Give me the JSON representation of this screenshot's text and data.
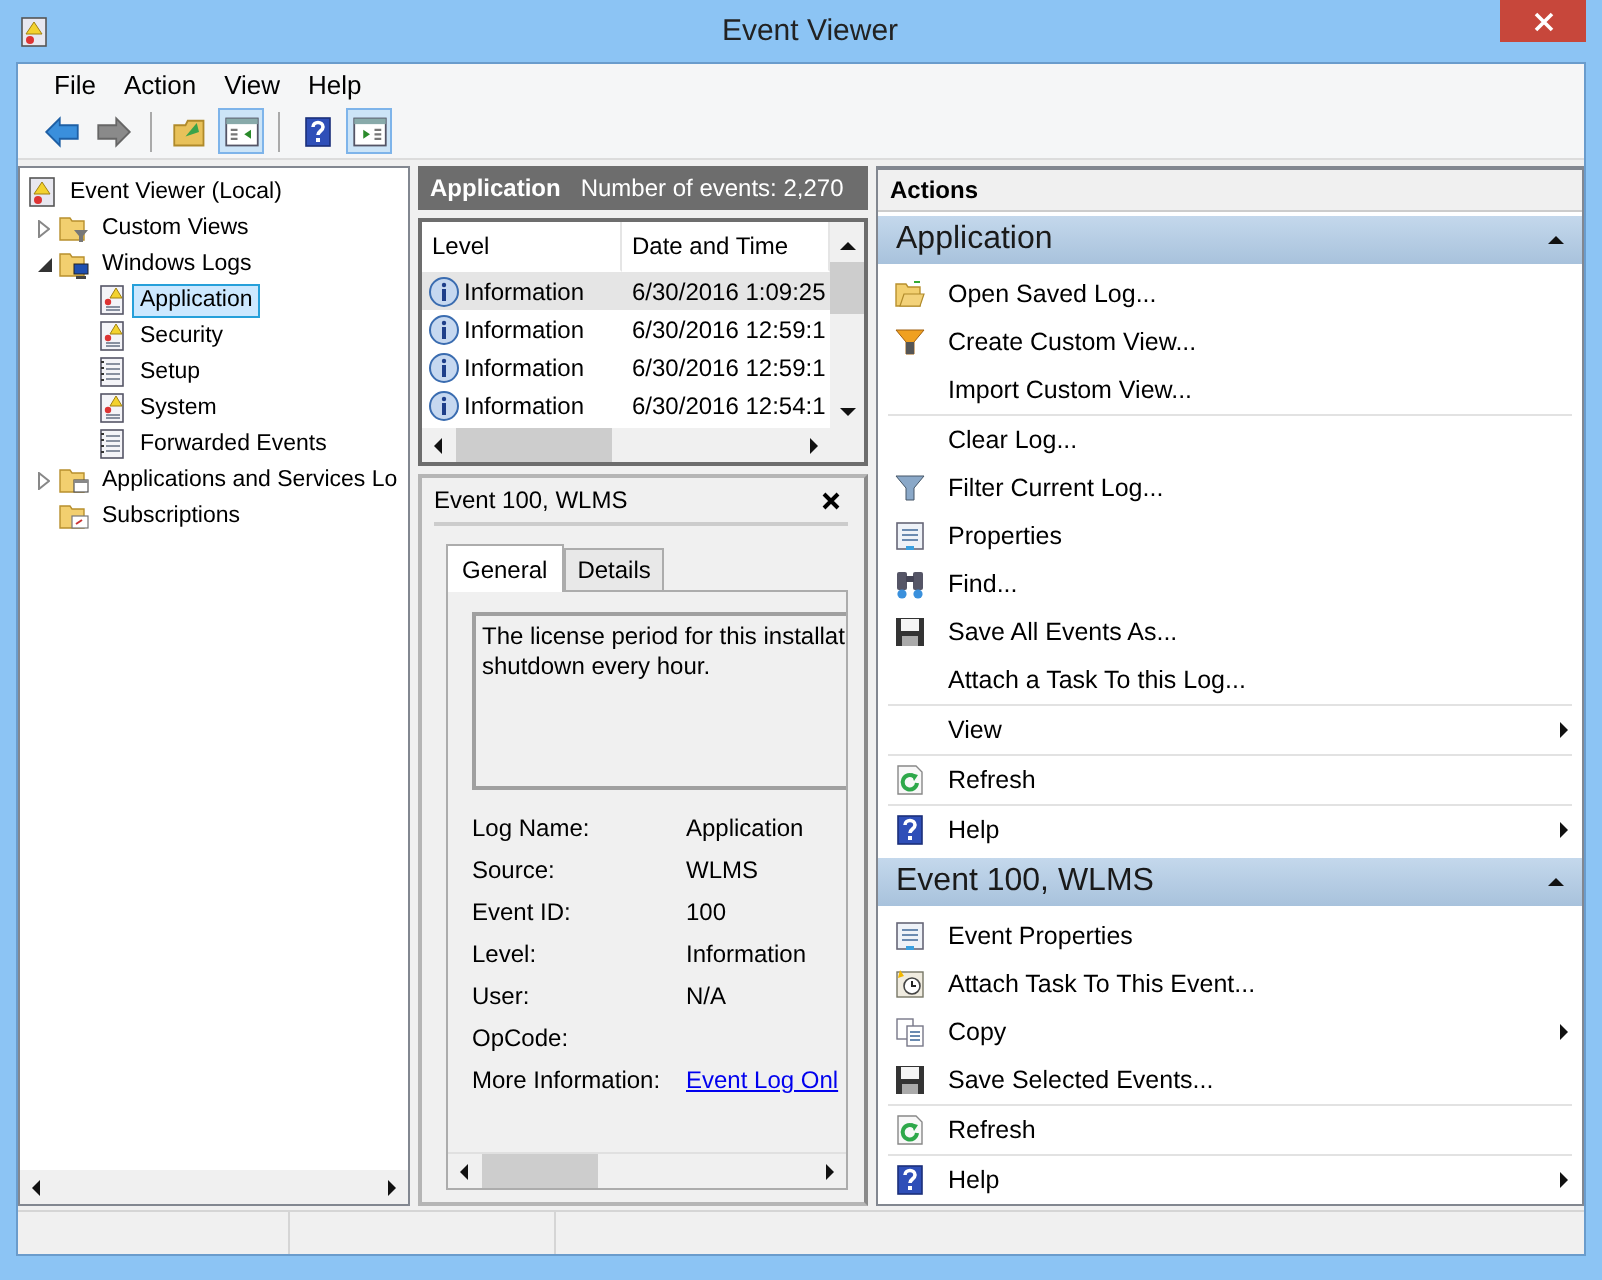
{
  "window": {
    "title": "Event Viewer"
  },
  "menu": [
    {
      "label": "File"
    },
    {
      "label": "Action"
    },
    {
      "label": "View"
    },
    {
      "label": "Help"
    }
  ],
  "toolbar": [
    {
      "kind": "back",
      "pressed": false
    },
    {
      "kind": "forward",
      "pressed": false
    },
    {
      "kind": "up",
      "pressed": false
    },
    {
      "kind": "tree-pane",
      "pressed": true
    },
    {
      "kind": "help",
      "pressed": false
    },
    {
      "kind": "action-pane",
      "pressed": true
    }
  ],
  "tree": [
    {
      "label": "Event Viewer (Local)",
      "kind": "root",
      "selected": false,
      "children": [
        {
          "label": "Custom Views",
          "kind": "folder-filter",
          "expanded": false,
          "selected": false
        },
        {
          "label": "Windows Logs",
          "kind": "folder-computer",
          "expanded": true,
          "selected": false,
          "children": [
            {
              "label": "Application",
              "kind": "log-alert",
              "selected": true
            },
            {
              "label": "Security",
              "kind": "log-alert",
              "selected": false
            },
            {
              "label": "Setup",
              "kind": "log",
              "selected": false
            },
            {
              "label": "System",
              "kind": "log-alert",
              "selected": false
            },
            {
              "label": "Forwarded Events",
              "kind": "log",
              "selected": false
            }
          ]
        },
        {
          "label": "Applications and Services Lo",
          "kind": "folder-window",
          "expanded": false,
          "selected": false
        },
        {
          "label": "Subscriptions",
          "kind": "subscriptions",
          "selected": false
        }
      ]
    }
  ],
  "events": {
    "title": "Application",
    "count": "Number of events: 2,270",
    "columns": [
      "Level",
      "Date and Time"
    ],
    "rows": [
      {
        "level": "Information",
        "date": "6/30/2016 1:09:25",
        "selected": true
      },
      {
        "level": "Information",
        "date": "6/30/2016 12:59:1",
        "selected": false
      },
      {
        "level": "Information",
        "date": "6/30/2016 12:59:1",
        "selected": false
      },
      {
        "level": "Information",
        "date": "6/30/2016 12:54:1",
        "selected": false
      }
    ]
  },
  "detail": {
    "title": "Event 100, WLMS",
    "tabs": [
      {
        "label": "General",
        "selected": true
      },
      {
        "label": "Details",
        "selected": false
      }
    ],
    "message": [
      "The license period for this installat",
      "shutdown every hour."
    ],
    "fields": [
      {
        "label": "Log Name:",
        "value": "Application",
        "kind": "text"
      },
      {
        "label": "Source:",
        "value": "WLMS",
        "kind": "text"
      },
      {
        "label": "Event ID:",
        "value": "100",
        "kind": "text"
      },
      {
        "label": "Level:",
        "value": "Information",
        "kind": "text"
      },
      {
        "label": "User:",
        "value": "N/A",
        "kind": "text"
      },
      {
        "label": "OpCode:",
        "kind": "text"
      },
      {
        "label": "More Information:",
        "value": "Event Log Onl",
        "kind": "link"
      }
    ]
  },
  "actions": {
    "title": "Actions",
    "sections": [
      {
        "title": "Application",
        "expanded": true,
        "items": [
          {
            "label": "Open Saved Log...",
            "kind": "open-folder"
          },
          {
            "label": "Create Custom View...",
            "kind": "filter-star"
          },
          {
            "label": "Import Custom View..."
          },
          {
            "label": "Clear Log...",
            "separator": true
          },
          {
            "label": "Filter Current Log...",
            "kind": "filter"
          },
          {
            "label": "Properties",
            "kind": "properties"
          },
          {
            "label": "Find...",
            "kind": "binoculars"
          },
          {
            "label": "Save All Events As...",
            "kind": "save"
          },
          {
            "label": "Attach a Task To this Log..."
          },
          {
            "label": "View",
            "separator": true,
            "submenu": true
          },
          {
            "label": "Refresh",
            "separator": true,
            "kind": "refresh"
          },
          {
            "label": "Help",
            "separator": true,
            "submenu": true,
            "kind": "help"
          }
        ]
      },
      {
        "title": "Event 100, WLMS",
        "expanded": true,
        "items": [
          {
            "label": "Event Properties",
            "kind": "properties"
          },
          {
            "label": "Attach Task To This Event...",
            "kind": "clock"
          },
          {
            "label": "Copy",
            "kind": "copy",
            "submenu": true
          },
          {
            "label": "Save Selected Events...",
            "kind": "save"
          },
          {
            "label": "Refresh",
            "separator": true,
            "kind": "refresh"
          },
          {
            "label": "Help",
            "separator": true,
            "submenu": true,
            "kind": "help"
          }
        ]
      }
    ]
  }
}
